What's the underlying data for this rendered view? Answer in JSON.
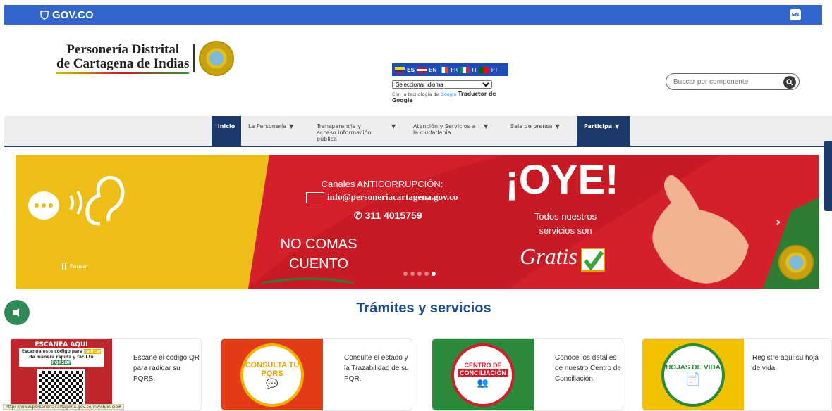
{
  "govbar": {
    "logo": "GOV.CO",
    "lang_button": "EN"
  },
  "brand": {
    "line1": "Personería Distrital",
    "line2": "de Cartagena de  Indias"
  },
  "translate": {
    "languages": [
      "ES",
      "EN",
      "FR",
      "IT",
      "PT"
    ],
    "select_value": "Seleccionar idioma",
    "powered_prefix": "Con la tecnología de",
    "powered_google": "Google",
    "powered_suffix": "Traductor de Google"
  },
  "search": {
    "placeholder": "Buscar por componente"
  },
  "nav": {
    "items": [
      {
        "label": "Inicio",
        "caret": ""
      },
      {
        "label": "La Personería",
        "caret": "▼"
      },
      {
        "label": "Transparencia y acceso información pública",
        "caret": "▼"
      },
      {
        "label": "Atención y Servicios a la ciudadanía",
        "caret": "▼"
      },
      {
        "label": "Sala de prensa",
        "caret": "▼"
      },
      {
        "label": "Participa",
        "caret": "▼"
      }
    ]
  },
  "banner": {
    "channels_title": "Canales ANTICORRUPCIÓN:",
    "email": "info@personeriacartagena.gov.co",
    "phone": "311 4015759",
    "slogan_line1": "NO COMAS",
    "slogan_line2": "CUENTO",
    "oye": "¡OYE!",
    "services_line1": "Todos nuestros",
    "services_line2": "servicios son",
    "gratis": "Gratis",
    "pause_label": "Pausar",
    "slides": 5,
    "active_slide": 4
  },
  "section": {
    "title": "Trámites y servicios"
  },
  "cards": [
    {
      "badge_line1": "",
      "badge_line2": "",
      "qr_title": "ESCANEA AQUÍ",
      "qr_sub": "Escanea este código para",
      "qr_sub2": "radicar",
      "qr_sub3": "de manera rápida y fácil tu",
      "qr_sub4": "PQRSDF",
      "desc": "Escane el codigo QR para radicar su PQRS."
    },
    {
      "badge_line1": "CONSULTA TU",
      "badge_line2": "PQRS",
      "desc": "Consulte el estado y la Trazabilidad de su PQR."
    },
    {
      "badge_line1": "CENTRO DE",
      "badge_line2": "CONCILIACIÓN",
      "desc": "Conoce los detalles de nuestro Centro de Conciliación."
    },
    {
      "badge_line1": "HOJAS DE VIDA",
      "badge_line2": "",
      "desc": "Registre aqui su hoja de vida."
    }
  ],
  "status_url": "https://www.personeriacartagena.gov.co/inweb/inicio#",
  "colors": {
    "govbar": "#3366cc",
    "nav_active": "#1c3a6b",
    "banner_red": "#d4202a",
    "banner_yellow": "#f2c200",
    "title_blue": "#1e4d8c"
  }
}
